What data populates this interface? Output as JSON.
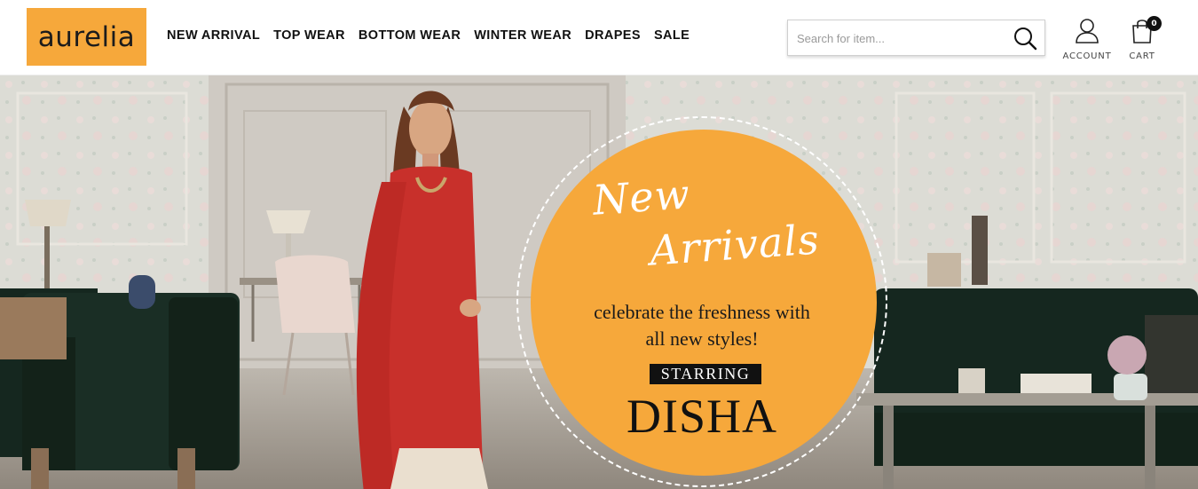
{
  "brand": {
    "logo_text": "aurelia"
  },
  "nav": {
    "items": [
      {
        "label": "NEW ARRIVAL"
      },
      {
        "label": "TOP WEAR"
      },
      {
        "label": "BOTTOM WEAR"
      },
      {
        "label": "WINTER WEAR"
      },
      {
        "label": "DRAPES"
      },
      {
        "label": "SALE"
      }
    ]
  },
  "search": {
    "placeholder": "Search for item...",
    "value": "",
    "icon": "search-icon"
  },
  "account": {
    "label": "ACCOUNT",
    "icon": "user-icon"
  },
  "cart": {
    "label": "CART",
    "count": "0",
    "icon": "shopping-bag-icon"
  },
  "hero": {
    "headline_line1": "New",
    "headline_line2": "Arrivals",
    "tagline_line1": "celebrate the freshness with",
    "tagline_line2": "all new styles!",
    "starring_label": "STARRING",
    "star_name": "DISHA"
  },
  "colors": {
    "accent": "#f6a83b",
    "text": "#111111",
    "header_bg": "#ffffff"
  }
}
